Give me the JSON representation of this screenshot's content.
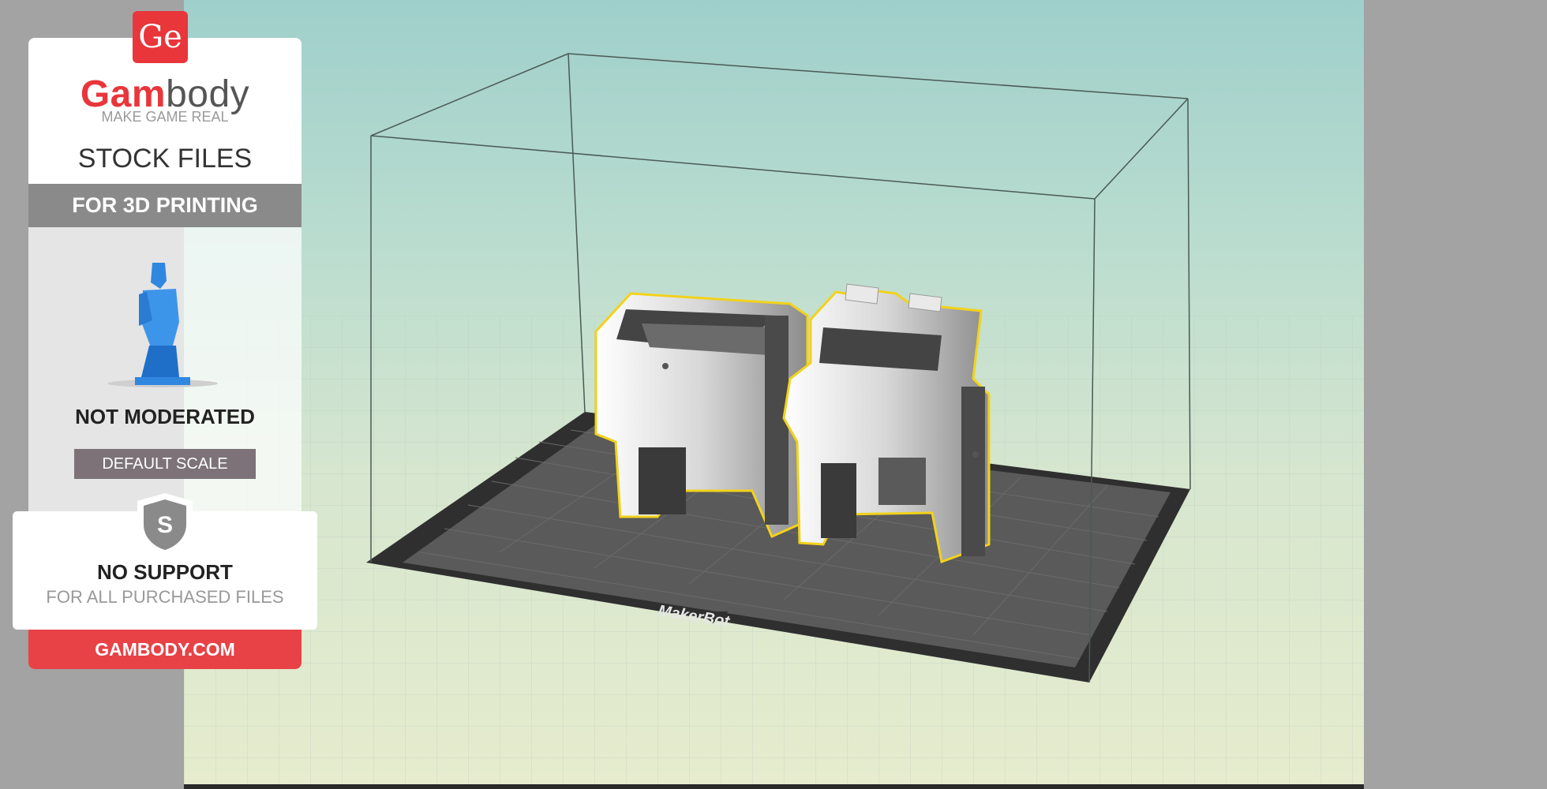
{
  "panel": {
    "logo_mark": "Ge",
    "brand_part1": "Gam",
    "brand_part2": "body",
    "tagline": "MAKE GAME REAL",
    "stock": "STOCK FILES",
    "printing": "FOR 3D PRINTING",
    "moderation": "NOT MODERATED",
    "scale": "DEFAULT SCALE",
    "shield_letter": "S",
    "support": "NO SUPPORT",
    "support_sub": "FOR ALL PURCHASED FILES",
    "site": "GAMBODY.COM",
    "figure_icon": "figurine-icon"
  },
  "viewport": {
    "plate_brand": "MakerBot"
  },
  "colors": {
    "brand_red": "#e8363b",
    "model_outline": "#f2d21b",
    "model_fill": "#dcdcdc",
    "plate": "#595959"
  }
}
